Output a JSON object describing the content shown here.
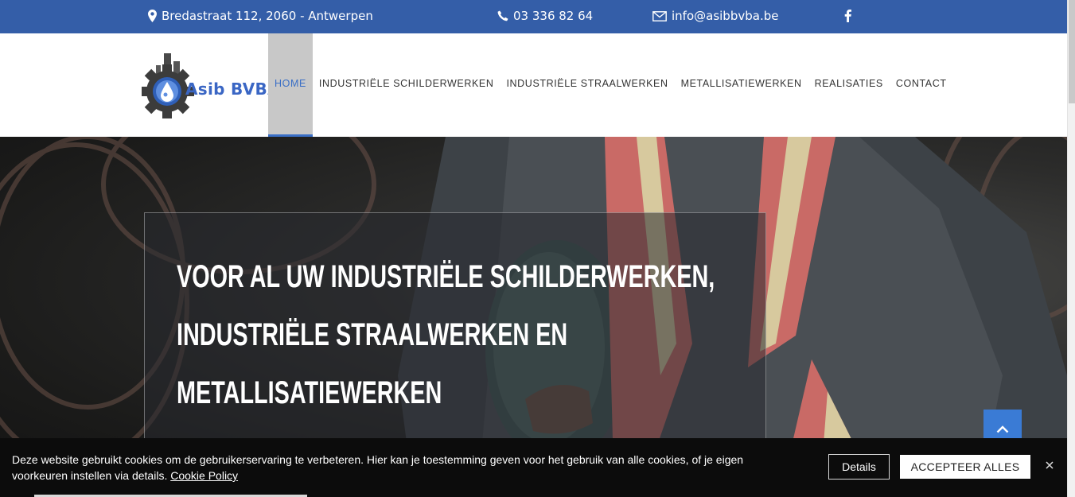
{
  "topbar": {
    "address": "Bredastraat 112, 2060 - Antwerpen",
    "phone": "03 336 82 64",
    "email": "info@asibbvba.be"
  },
  "logo": {
    "text": "Asib BVBA"
  },
  "nav": {
    "home": "HOME",
    "schilderwerken": "INDUSTRIËLE SCHILDERWERKEN",
    "straalwerken": "INDUSTRIËLE STRAALWERKEN",
    "metallisatie": "METALLISATIEWERKEN",
    "realisaties": "REALISATIES",
    "contact": "CONTACT"
  },
  "hero": {
    "line1": "VOOR AL UW INDUSTRIËLE SCHILDERWERKEN,",
    "line2": "INDUSTRIËLE STRAALWERKEN EN",
    "line3": "METALLISATIEWERKEN"
  },
  "cookie": {
    "line1": "Deze website gebruikt cookies om de gebruikerservaring te verbeteren. Hier kan je toestemming geven voor het gebruik van alle cookies, of je eigen",
    "line2": "voorkeuren instellen via details.",
    "policy_link": "Cookie Policy",
    "details_label": "Details",
    "accept_label": "ACCEPTEER ALLES"
  },
  "colors": {
    "topbar": "#345ea8",
    "accent": "#3a6fc6",
    "active_tab": "#c8c8c8",
    "cookie_bg": "#0c0c0c"
  },
  "icons": [
    "map-marker-icon",
    "phone-icon",
    "envelope-icon",
    "facebook-icon",
    "chevron-up-icon",
    "close-icon"
  ]
}
